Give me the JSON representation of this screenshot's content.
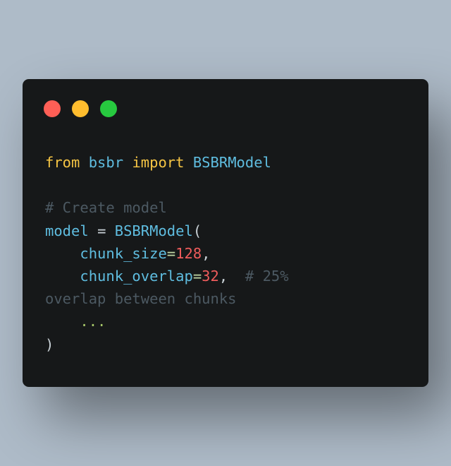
{
  "window": {
    "controls": [
      {
        "name": "close",
        "color": "#ff5f56"
      },
      {
        "name": "minimize",
        "color": "#ffbd2e"
      },
      {
        "name": "maximize",
        "color": "#27c93f"
      }
    ]
  },
  "code": {
    "line1": {
      "kw1": "from",
      "module": "bsbr",
      "kw2": "import",
      "cls": "BSBRModel"
    },
    "line3": {
      "comment": "# Create model"
    },
    "line4": {
      "var": "model",
      "eq": "=",
      "cls": "BSBRModel",
      "paren": "("
    },
    "line5": {
      "indent": "    ",
      "param": "chunk_size",
      "eq": "=",
      "value": "128",
      "comma": ","
    },
    "line6": {
      "indent": "    ",
      "param": "chunk_overlap",
      "eq": "=",
      "value": "32",
      "comma": ",",
      "gap": "  ",
      "comment": "# 25%"
    },
    "line7": {
      "comment": "overlap between chunks"
    },
    "line8": {
      "indent": "    ",
      "ellipsis": "..."
    },
    "line9": {
      "paren": ")"
    }
  }
}
